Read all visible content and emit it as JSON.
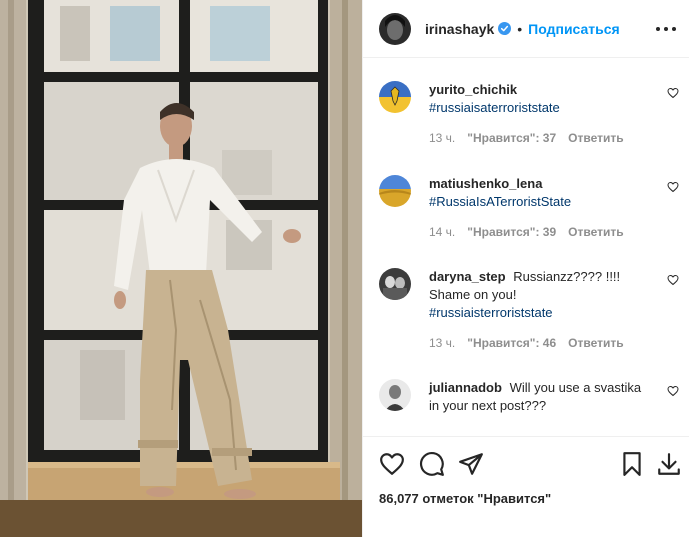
{
  "post": {
    "username": "irinashayk",
    "dot": "•",
    "follow_label": "Подписаться",
    "likes_total": "86,077 отметок \"Нравится\"",
    "photo_alt": "Woman in white shirt and beige trousers standing in a window"
  },
  "comments": [
    {
      "username": "yurito_chichik",
      "text": "",
      "hashtag": "#russiaisaterroriststate",
      "time": "13 ч.",
      "likes": "\"Нравится\": 37",
      "reply": "Ответить",
      "avatar": "ukraine-crest-avatar"
    },
    {
      "username": "matiushenko_lena",
      "text": "",
      "hashtag": "#RussiaIsATerroristState",
      "time": "14 ч.",
      "likes": "\"Нравится\": 39",
      "reply": "Ответить",
      "avatar": "wheat-field-avatar"
    },
    {
      "username": "daryna_step",
      "text": "Russianzz???? !!!! Shame on you!",
      "hashtag": "#russiaisterroriststate",
      "time": "13 ч.",
      "likes": "\"Нравится\": 46",
      "reply": "Ответить",
      "avatar": "couple-photo-avatar"
    },
    {
      "username": "juliannadob",
      "text": "Will you use a svastika in your next post???",
      "hashtag": "",
      "time": "",
      "likes": "",
      "reply": "",
      "avatar": "portrait-avatar"
    }
  ],
  "icons": {
    "more": "more-options-icon",
    "heart": "heart-icon",
    "comment": "comment-icon",
    "share": "send-icon",
    "save": "bookmark-icon",
    "download": "download-icon",
    "verified": "verified-badge-icon"
  },
  "colors": {
    "link": "#0095f6",
    "hashtag": "#00376b",
    "meta": "#8e8e8e",
    "text": "#262626"
  }
}
